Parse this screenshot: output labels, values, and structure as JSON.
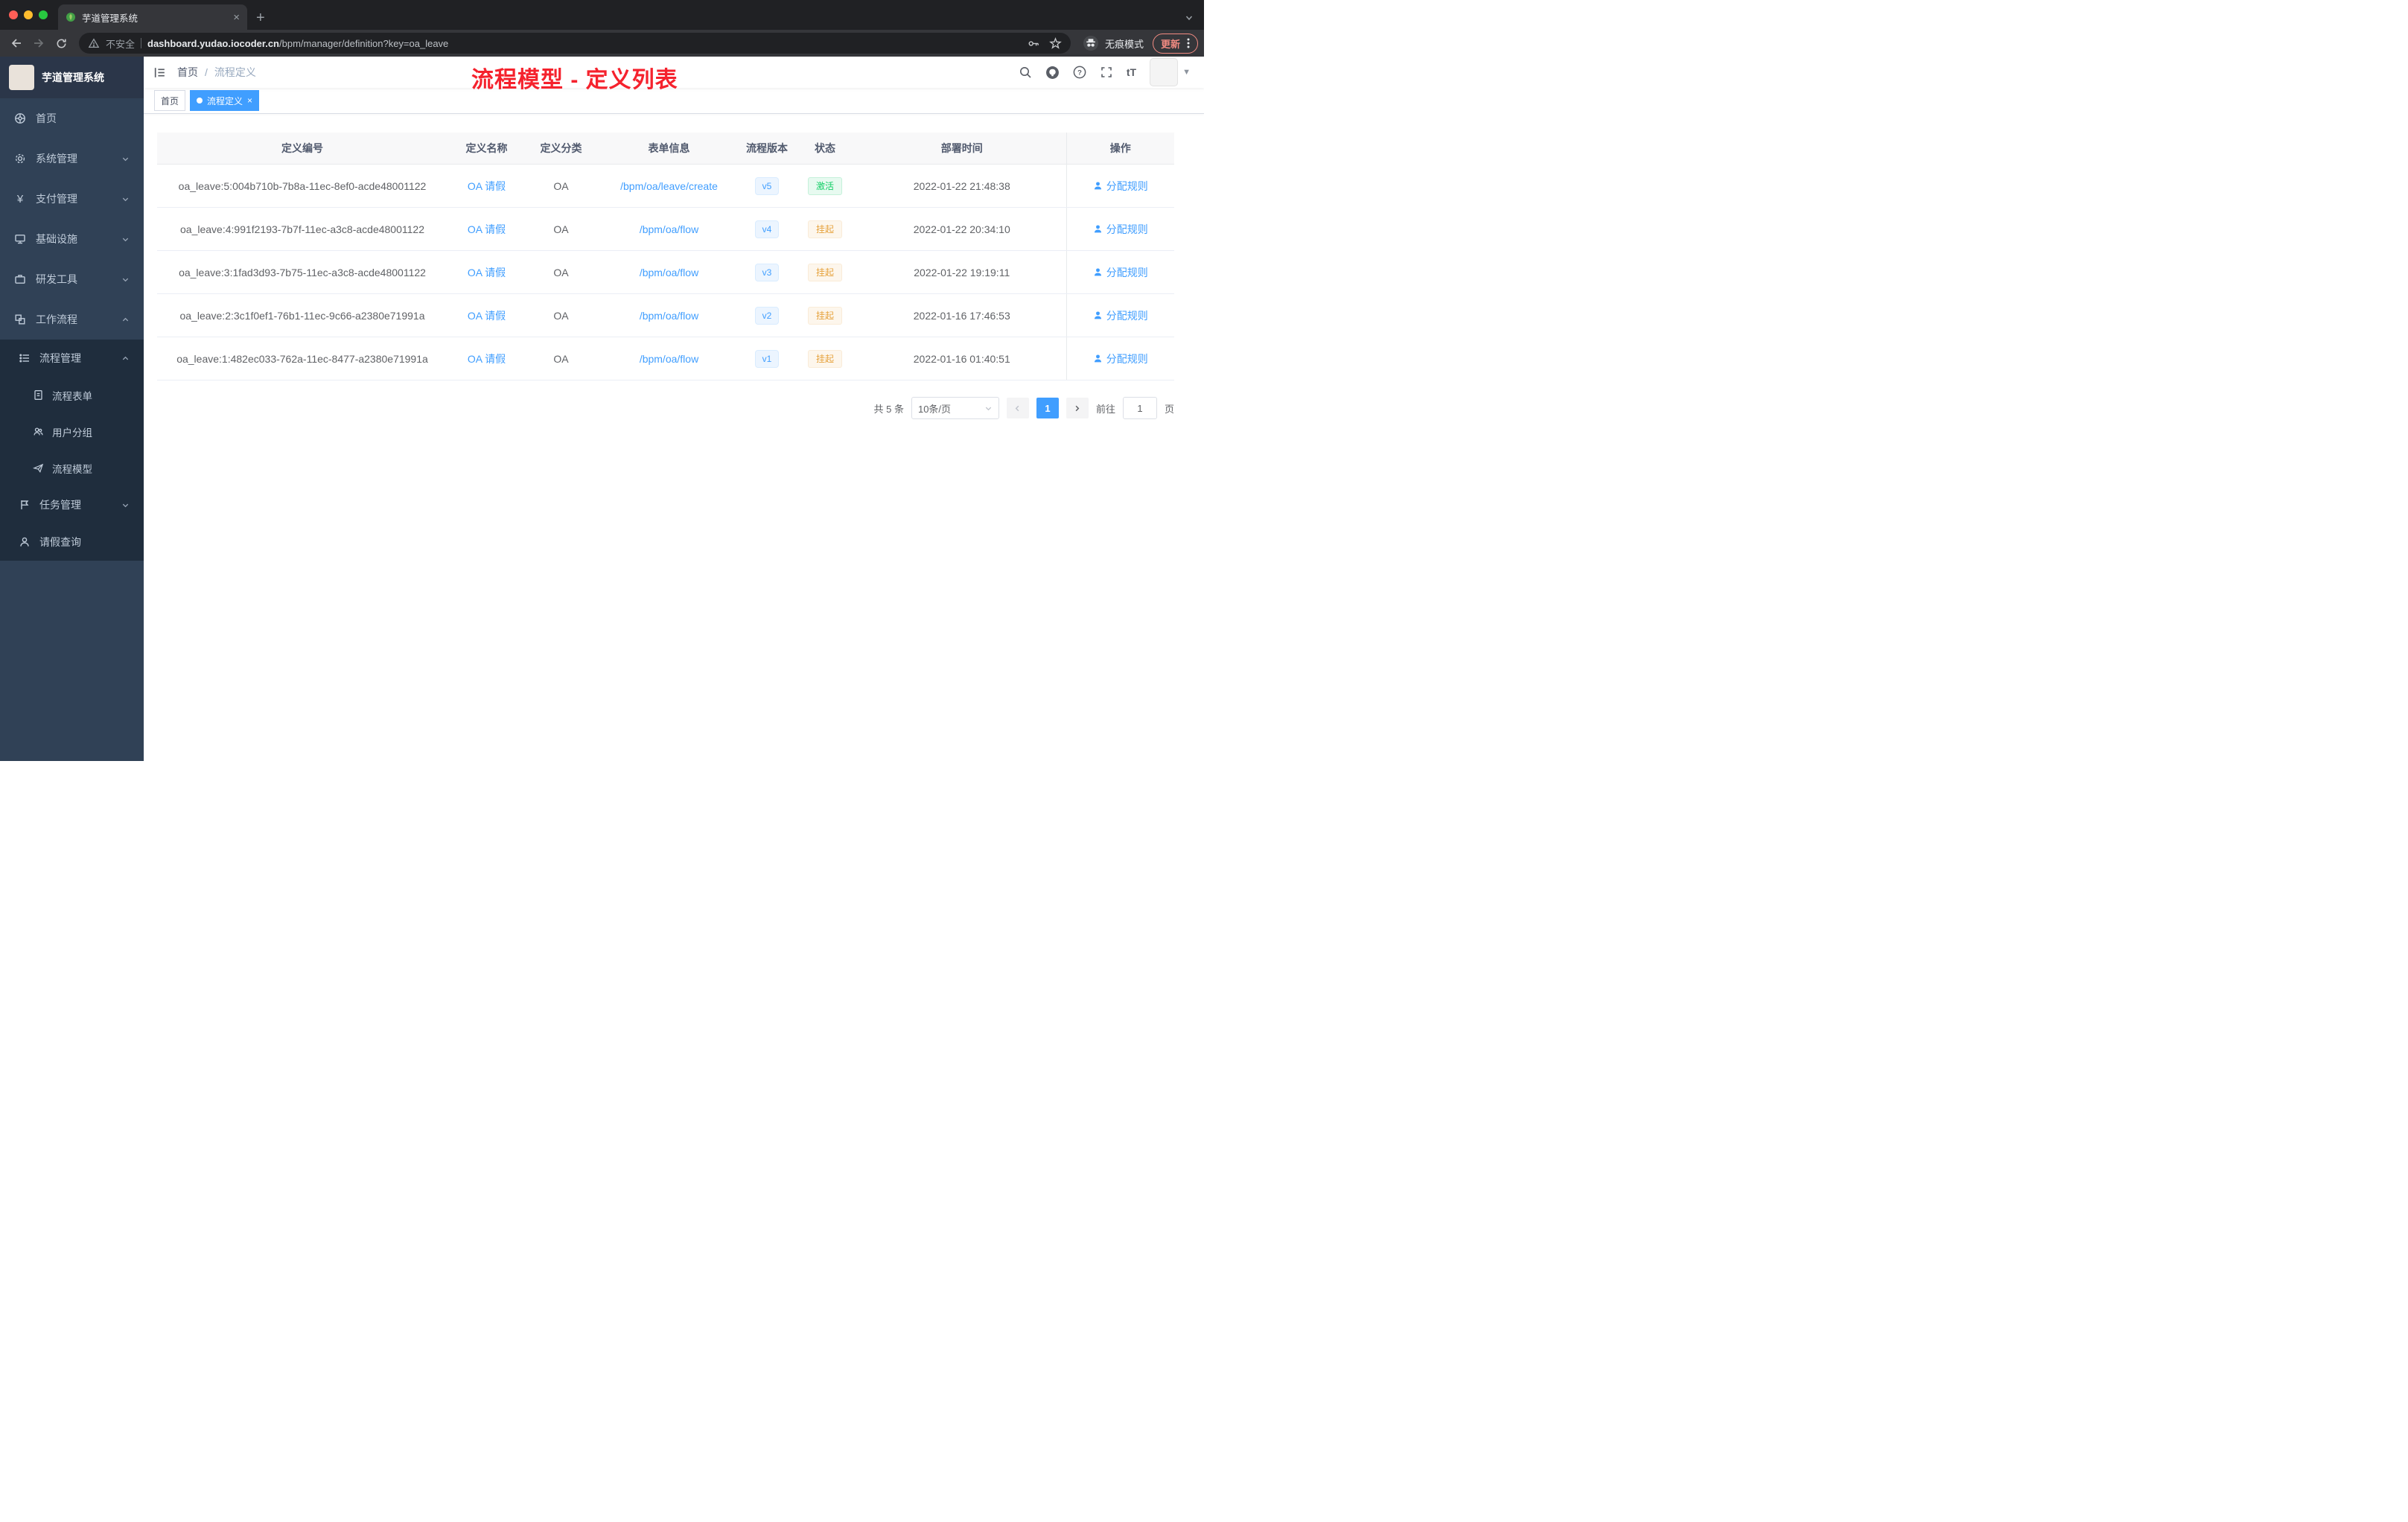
{
  "browser": {
    "tab_title": "芋道管理系统",
    "tab_close": "×",
    "new_tab": "+",
    "security_label": "不安全",
    "url_domain": "dashboard.yudao.iocoder.cn",
    "url_path": "/bpm/manager/definition?key=oa_leave",
    "incognito_label": "无痕模式",
    "update_label": "更新"
  },
  "sidebar": {
    "logo_title": "芋道管理系统",
    "items": [
      {
        "label": "首页"
      },
      {
        "label": "系统管理"
      },
      {
        "label": "支付管理"
      },
      {
        "label": "基础设施"
      },
      {
        "label": "研发工具"
      },
      {
        "label": "工作流程"
      },
      {
        "label": "流程管理"
      },
      {
        "label": "流程表单"
      },
      {
        "label": "用户分组"
      },
      {
        "label": "流程模型"
      },
      {
        "label": "任务管理"
      },
      {
        "label": "请假查询"
      }
    ],
    "yen_glyph": "¥"
  },
  "navbar": {
    "breadcrumb_home": "首页",
    "breadcrumb_sep": "/",
    "breadcrumb_current": "流程定义",
    "font_size_icon_label": "tT",
    "help_glyph": "?"
  },
  "annotation": "流程模型 - 定义列表",
  "tags": {
    "items": [
      {
        "label": "首页",
        "active": false
      },
      {
        "label": "流程定义",
        "active": true,
        "close": "×"
      }
    ]
  },
  "table": {
    "columns": [
      "定义编号",
      "定义名称",
      "定义分类",
      "表单信息",
      "流程版本",
      "状态",
      "部署时间",
      "操作"
    ],
    "rows": [
      {
        "id": "oa_leave:5:004b710b-7b8a-11ec-8ef0-acde48001122",
        "name": "OA 请假",
        "category": "OA",
        "form": "/bpm/oa/leave/create",
        "version": "v5",
        "status": "激活",
        "status_type": "success",
        "deploy_time": "2022-01-22 21:48:38",
        "action": "分配规则"
      },
      {
        "id": "oa_leave:4:991f2193-7b7f-11ec-a3c8-acde48001122",
        "name": "OA 请假",
        "category": "OA",
        "form": "/bpm/oa/flow",
        "version": "v4",
        "status": "挂起",
        "status_type": "warning",
        "deploy_time": "2022-01-22 20:34:10",
        "action": "分配规则"
      },
      {
        "id": "oa_leave:3:1fad3d93-7b75-11ec-a3c8-acde48001122",
        "name": "OA 请假",
        "category": "OA",
        "form": "/bpm/oa/flow",
        "version": "v3",
        "status": "挂起",
        "status_type": "warning",
        "deploy_time": "2022-01-22 19:19:11",
        "action": "分配规则"
      },
      {
        "id": "oa_leave:2:3c1f0ef1-76b1-11ec-9c66-a2380e71991a",
        "name": "OA 请假",
        "category": "OA",
        "form": "/bpm/oa/flow",
        "version": "v2",
        "status": "挂起",
        "status_type": "warning",
        "deploy_time": "2022-01-16 17:46:53",
        "action": "分配规则"
      },
      {
        "id": "oa_leave:1:482ec033-762a-11ec-8477-a2380e71991a",
        "name": "OA 请假",
        "category": "OA",
        "form": "/bpm/oa/flow",
        "version": "v1",
        "status": "挂起",
        "status_type": "warning",
        "deploy_time": "2022-01-16 01:40:51",
        "action": "分配规则"
      }
    ]
  },
  "pagination": {
    "total": "共 5 条",
    "page_size": "10条/页",
    "page": "1",
    "goto": "前往",
    "unit": "页",
    "goto_value": "1"
  }
}
